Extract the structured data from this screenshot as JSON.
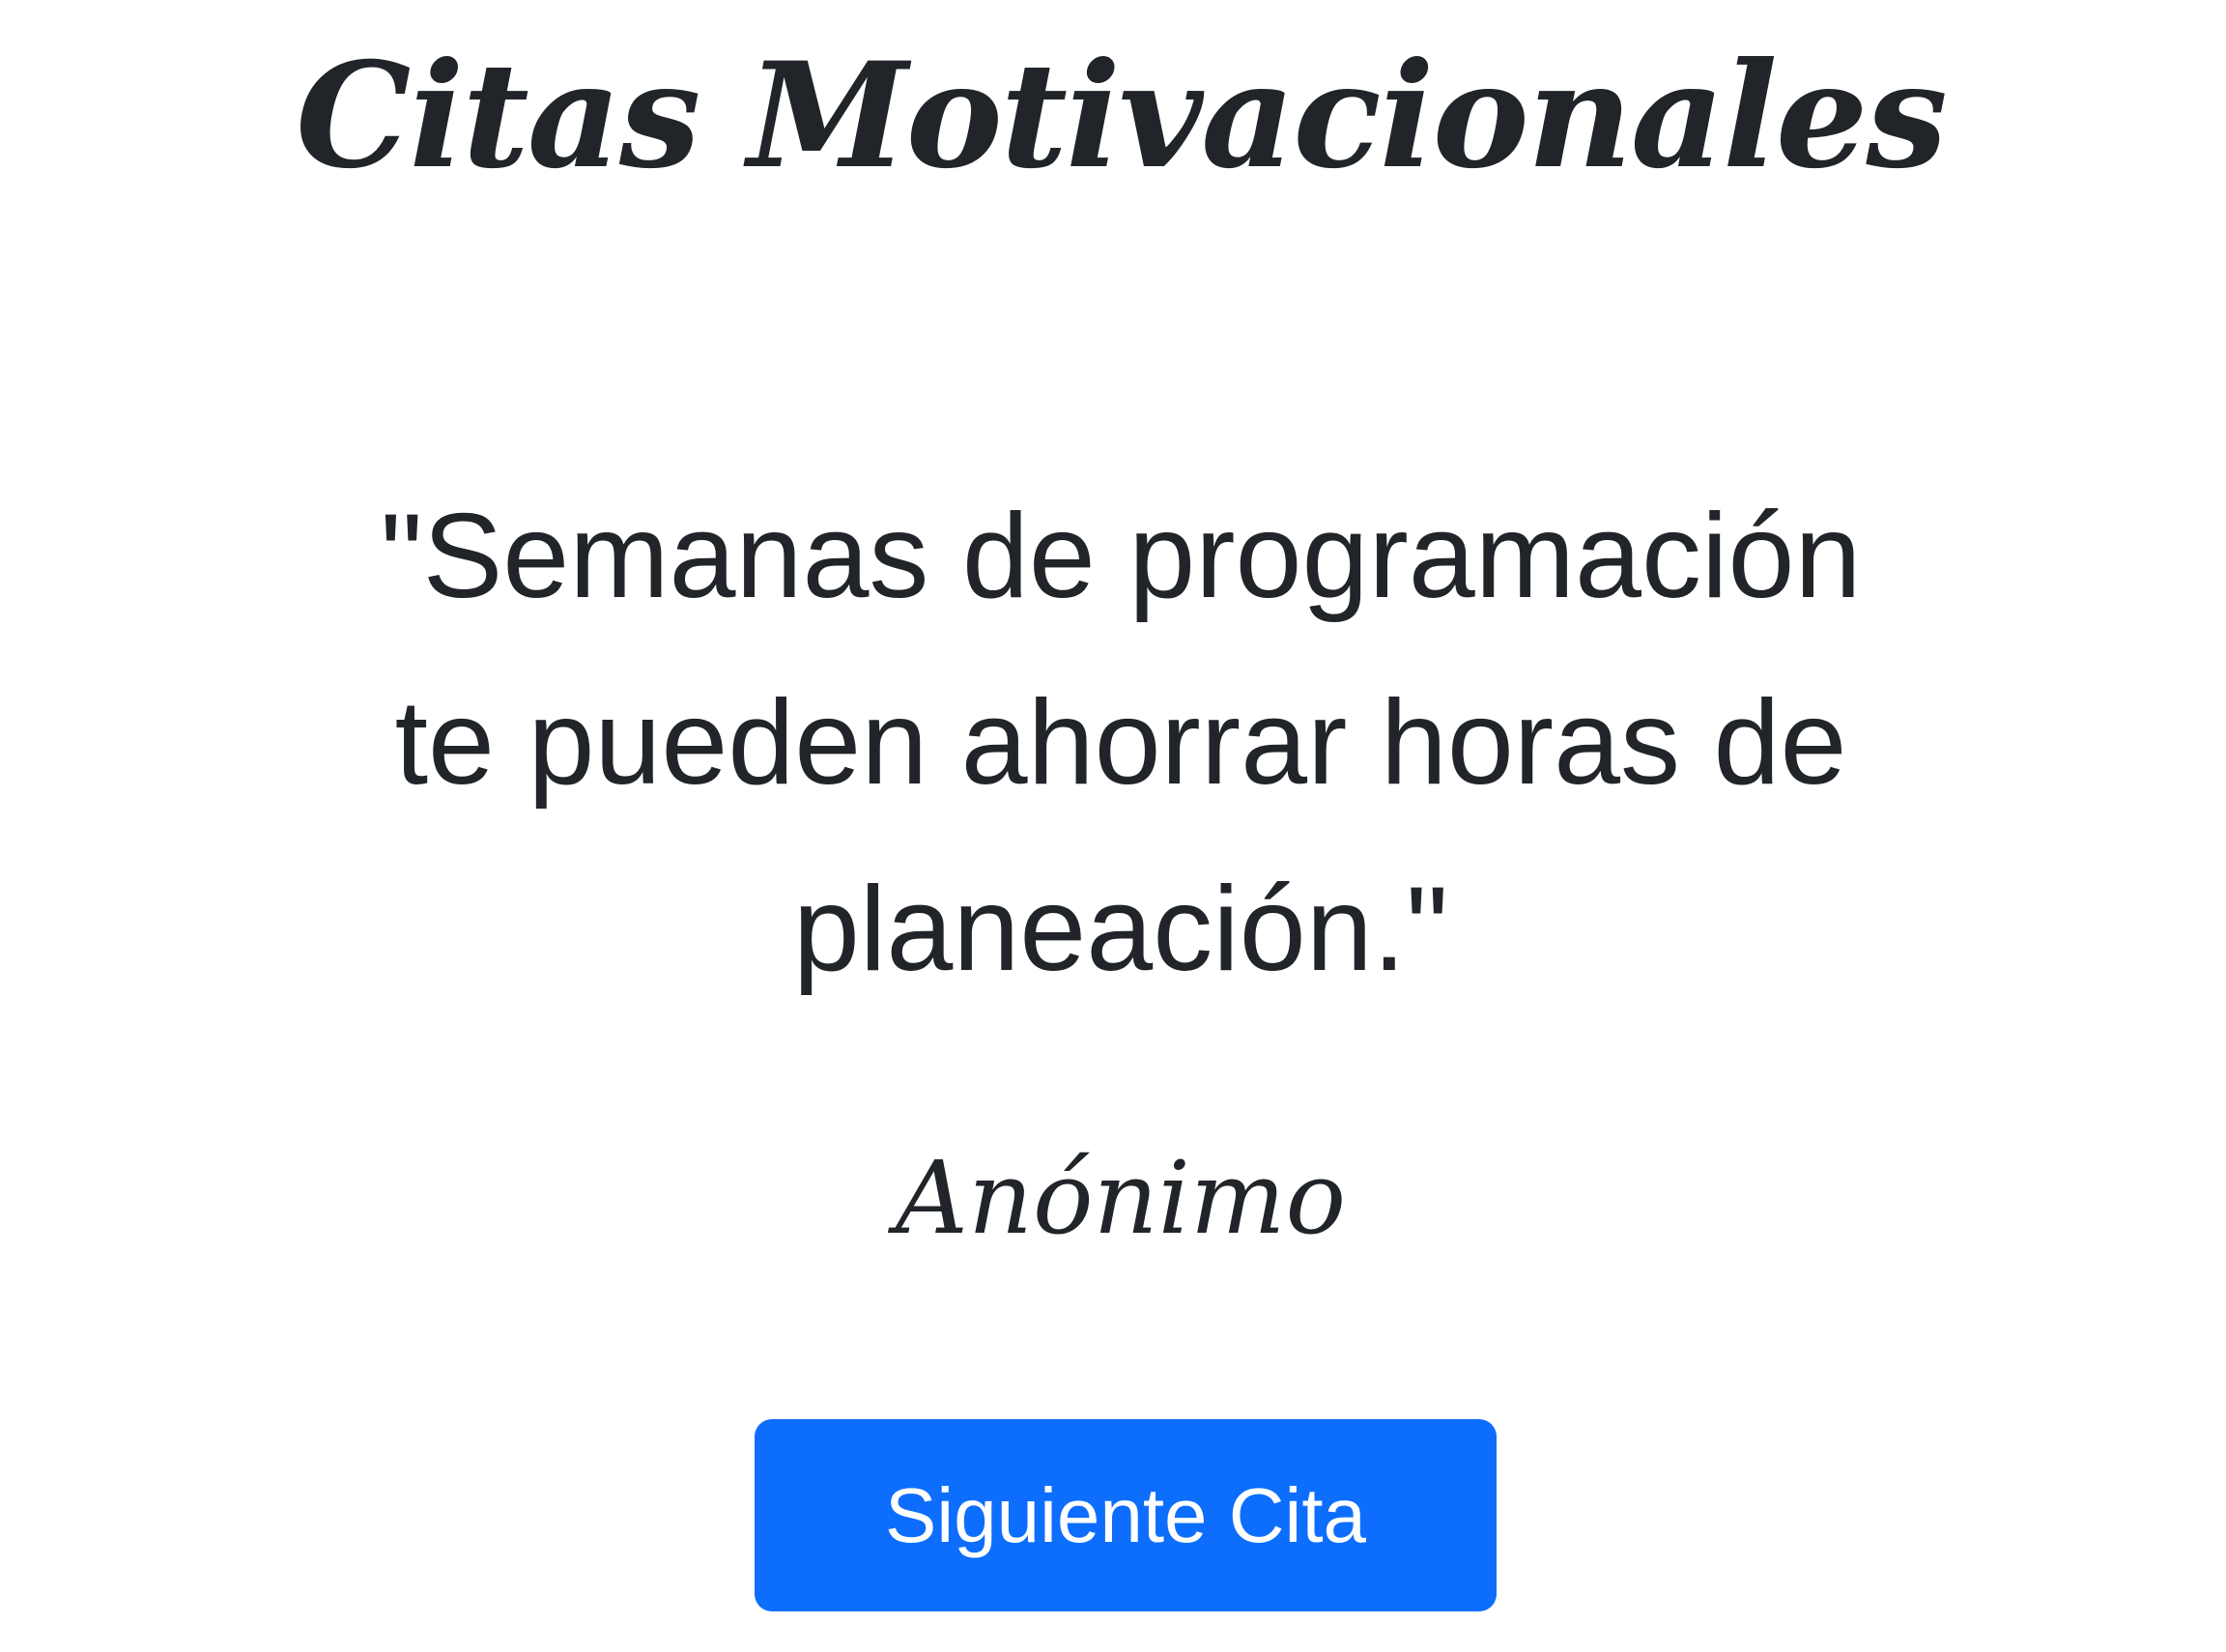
{
  "header": {
    "title": "Citas Motivacionales"
  },
  "quote": {
    "text": "\"Semanas de programación te pueden ahorrar horas de planeación.\"",
    "author": "Anónimo"
  },
  "actions": {
    "next_label": "Siguiente Cita"
  },
  "colors": {
    "background": "#ffffff",
    "text": "#212529",
    "button_background": "#0d6efd",
    "button_text": "#ffffff"
  }
}
